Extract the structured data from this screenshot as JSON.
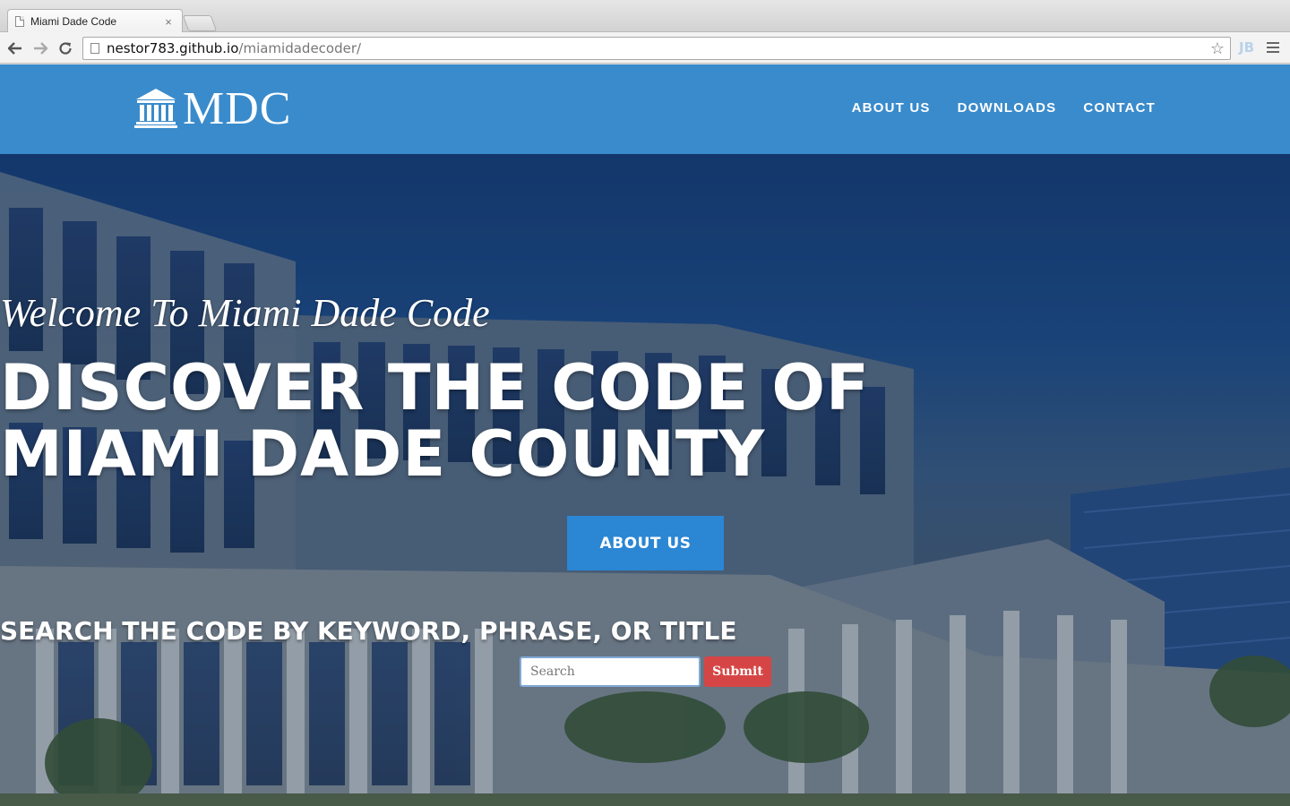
{
  "browser": {
    "tab_title": "Miami Dade Code",
    "tab_close": "×",
    "url_host": "nestor783.github.io",
    "url_path": "/miamidadecoder/",
    "extension_label": "JB"
  },
  "header": {
    "logo_text": "MDC",
    "nav": [
      "ABOUT US",
      "DOWNLOADS",
      "CONTACT"
    ],
    "background_color": "#3a8bcb"
  },
  "hero": {
    "welcome": "Welcome To Miami Dade Code",
    "headline_line1": "DISCOVER THE CODE OF",
    "headline_line2": "MIAMI DADE COUNTY",
    "cta_label": "ABOUT US",
    "search_title": "SEARCH THE CODE BY KEYWORD, PHRASE, OR TITLE",
    "search_placeholder": "Search",
    "submit_label": "Submit",
    "cta_color": "#2b86d3",
    "submit_color": "#d64545"
  },
  "icons": {
    "logo": "courthouse-icon",
    "back": "back-arrow-icon",
    "forward": "forward-arrow-icon",
    "reload": "reload-icon",
    "bookmark": "star-icon",
    "menu": "hamburger-menu-icon"
  }
}
